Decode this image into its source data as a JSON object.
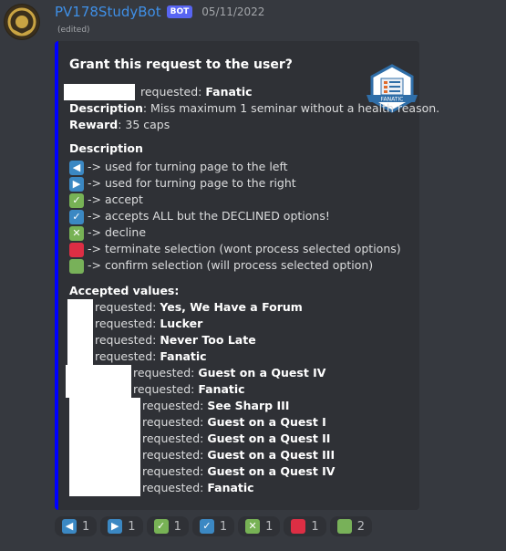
{
  "author": {
    "name": "PV178StudyBot",
    "bot_tag": "BOT",
    "timestamp": "05/11/2022",
    "edited": "(edited)"
  },
  "embed": {
    "accent": "#0000ff",
    "title": "Grant this request to the user?",
    "request_line": {
      "label": "requested:",
      "value": "Fanatic"
    },
    "description_line": {
      "label": "Description",
      "value": ": Miss maximum 1 seminar without a health reason."
    },
    "reward_line": {
      "label": "Reward",
      "value": ": 35 caps"
    },
    "description_heading": "Description",
    "legend": [
      {
        "icon": "left-arrow-icon",
        "text": "-> used for turning page to the left"
      },
      {
        "icon": "right-arrow-icon",
        "text": "-> used for turning page to the right"
      },
      {
        "icon": "check-icon",
        "text": "-> accept"
      },
      {
        "icon": "check-all-icon",
        "text": "-> accepts ALL but the DECLINED options!"
      },
      {
        "icon": "cross-icon",
        "text": "-> decline"
      },
      {
        "icon": "red-square-icon",
        "text": "-> terminate selection (wont process selected options)"
      },
      {
        "icon": "green-square-icon",
        "text": "-> confirm selection (will process selected option)"
      }
    ],
    "accepted_heading": "Accepted values:",
    "accepted": [
      {
        "label": "requested:",
        "value": "Yes, We Have a Forum"
      },
      {
        "label": "requested:",
        "value": "Lucker"
      },
      {
        "label": "requested:",
        "value": "Never Too Late"
      },
      {
        "label": "requested:",
        "value": "Fanatic"
      },
      {
        "label": "requested:",
        "value": "Guest on a Quest IV"
      },
      {
        "label": "requested:",
        "value": "Fanatic"
      },
      {
        "label": "requested:",
        "value": "See Sharp III"
      },
      {
        "label": "requested:",
        "value": "Guest on a Quest I"
      },
      {
        "label": "requested:",
        "value": "Guest on a Quest II"
      },
      {
        "label": "requested:",
        "value": "Guest on a Quest III"
      },
      {
        "label": "requested:",
        "value": "Guest on a Quest IV"
      },
      {
        "label": "requested:",
        "value": "Fanatic"
      }
    ],
    "thumbnail_label": "FANATIC"
  },
  "reactions": [
    {
      "icon": "left-arrow-icon",
      "count": "1"
    },
    {
      "icon": "right-arrow-icon",
      "count": "1"
    },
    {
      "icon": "check-icon",
      "count": "1"
    },
    {
      "icon": "check-all-icon",
      "count": "1"
    },
    {
      "icon": "cross-icon",
      "count": "1"
    },
    {
      "icon": "red-square-icon",
      "count": "1"
    },
    {
      "icon": "green-square-icon",
      "count": "2"
    }
  ]
}
